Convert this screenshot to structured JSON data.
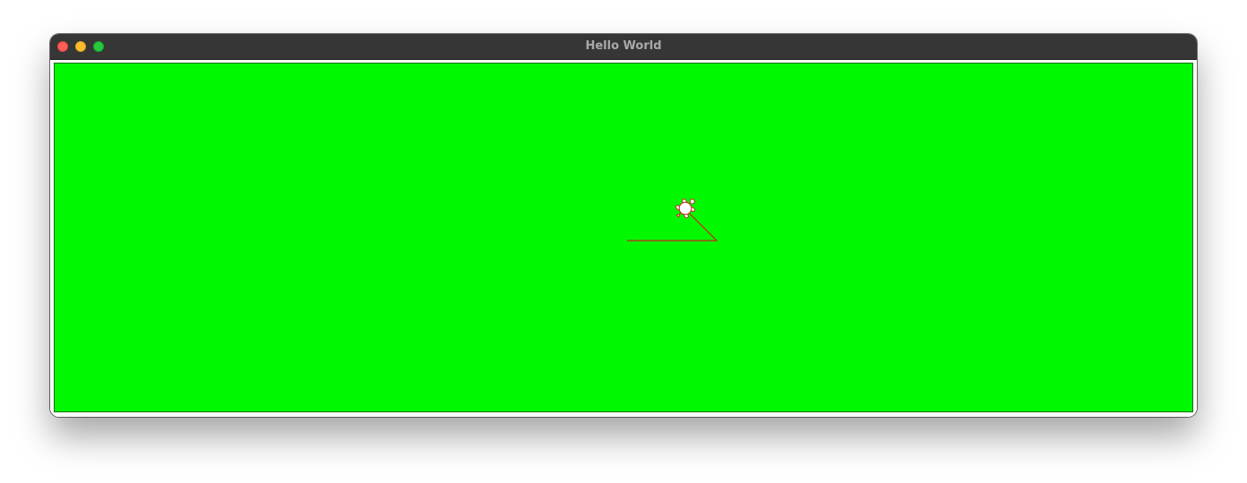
{
  "window": {
    "title": "Hello World",
    "controls": [
      "close",
      "minimize",
      "zoom"
    ]
  },
  "canvas": {
    "background_color": "#00f800",
    "pen_color": "#cc2222",
    "turtle_fill": "#ffffff",
    "turtle_icon": "turtle-icon"
  }
}
